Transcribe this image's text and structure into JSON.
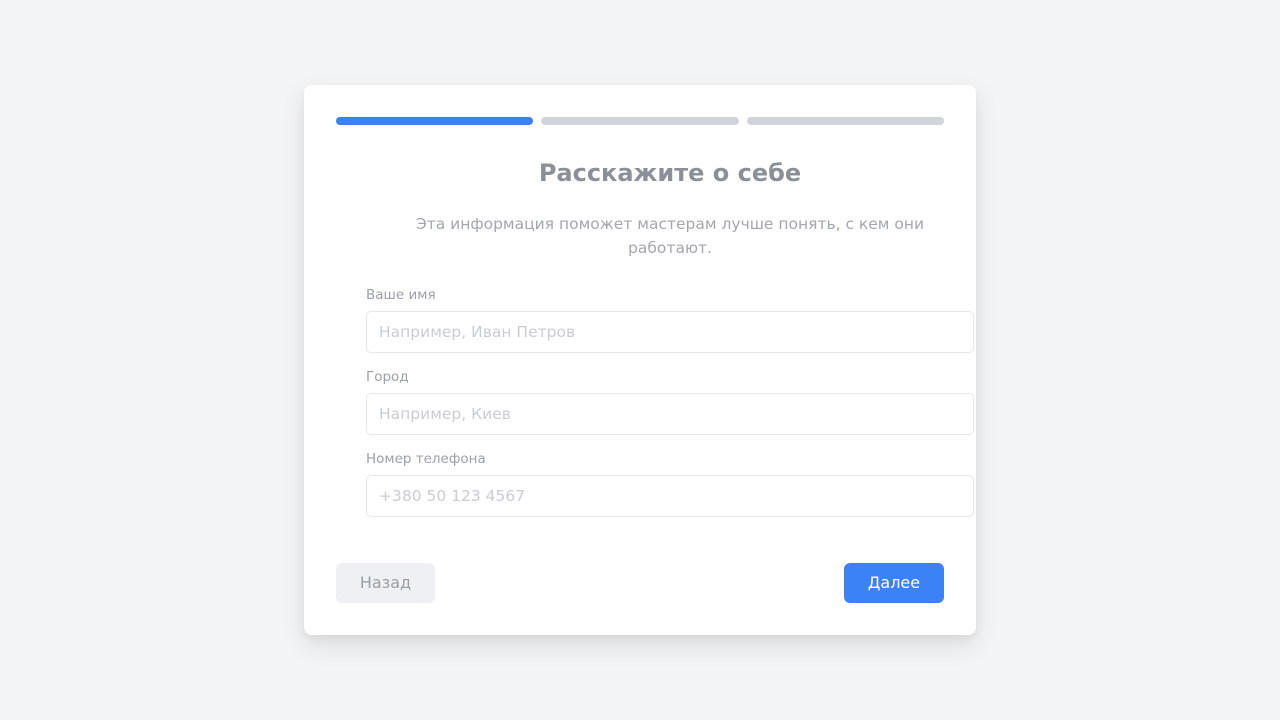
{
  "progress": {
    "steps_total": 3,
    "current_step": 1
  },
  "form": {
    "title": "Расскажите о себе",
    "subtitle": "Эта информация поможет мастерам лучше понять, с кем они работают.",
    "fields": {
      "name": {
        "label": "Ваше имя",
        "value": "",
        "placeholder": "Например, Иван Петров"
      },
      "city": {
        "label": "Город",
        "value": "",
        "placeholder": "Например, Киев"
      },
      "phone": {
        "label": "Номер телефона",
        "value": "",
        "placeholder": "+380 50 123 4567"
      }
    }
  },
  "actions": {
    "back_label": "Назад",
    "next_label": "Далее"
  },
  "colors": {
    "accent": "#3b82f6",
    "progress_inactive": "#d1d5db",
    "background": "#f3f4f6"
  }
}
